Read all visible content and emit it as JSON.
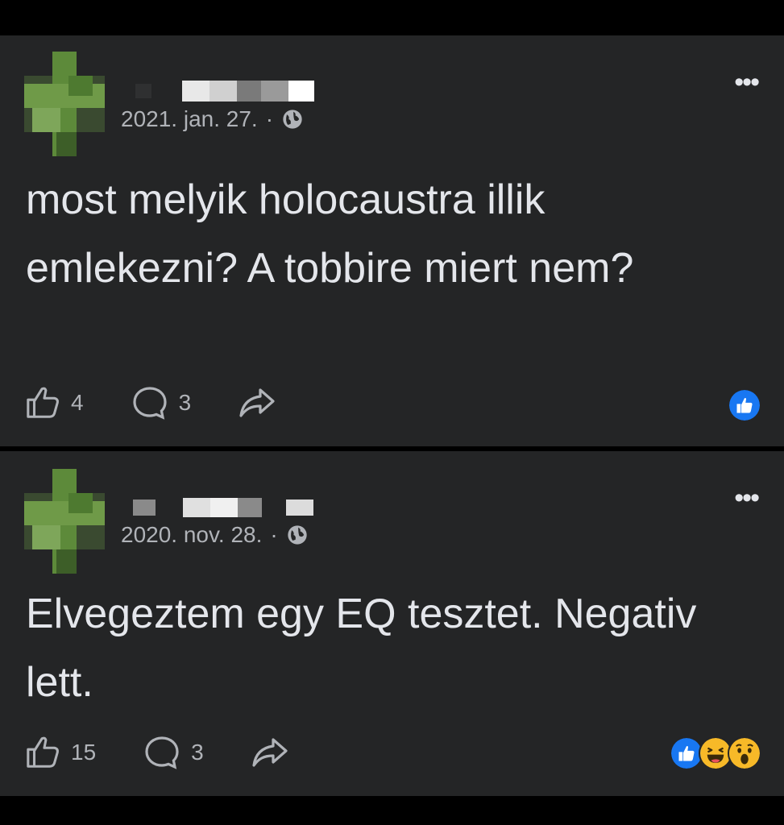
{
  "posts": [
    {
      "date": "2021. jan. 27.",
      "separator": "·",
      "privacy_icon": "globe-icon",
      "text": "most melyik holocaustra illik emlekezni? A tobbire miert nem?",
      "likes": "4",
      "comments": "3",
      "reactions": [
        "like"
      ]
    },
    {
      "date": "2020. nov. 28.",
      "separator": "·",
      "privacy_icon": "globe-icon",
      "text": "Elvegeztem egy EQ tesztet. Negativ lett.",
      "likes": "15",
      "comments": "3",
      "reactions": [
        "like",
        "haha",
        "wow"
      ]
    }
  ],
  "more_label": "•••",
  "colors": {
    "background": "#000000",
    "card": "#242526",
    "text_primary": "#e4e6eb",
    "text_secondary": "#b0b3b8",
    "like_blue": "#1877f2",
    "reaction_yellow": "#f7b928",
    "avatar_green": "#5d8a3a"
  }
}
